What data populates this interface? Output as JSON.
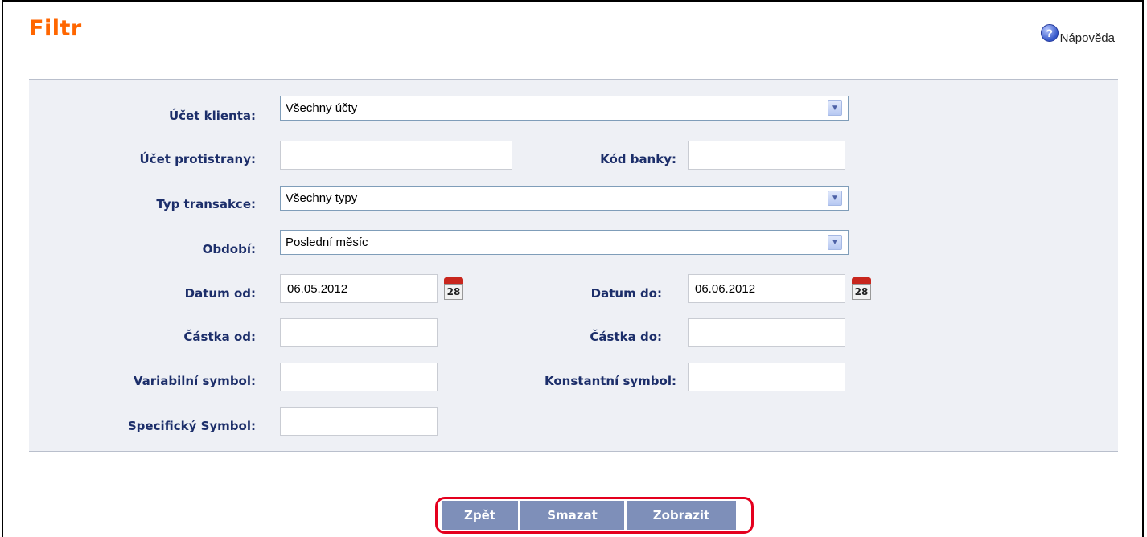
{
  "header": {
    "title": "Filtr",
    "help_label": "Nápověda"
  },
  "form": {
    "ucet_klienta": {
      "label": "Účet klienta:",
      "value": "Všechny účty"
    },
    "ucet_protistrany": {
      "label": "Účet protistrany:",
      "value": ""
    },
    "kod_banky": {
      "label": "Kód banky:",
      "value": ""
    },
    "typ_transakce": {
      "label": "Typ transakce:",
      "value": "Všechny typy"
    },
    "obdobi": {
      "label": "Období:",
      "value": "Poslední měsíc"
    },
    "datum_od": {
      "label": "Datum od:",
      "value": "06.05.2012",
      "calendar_day": "28"
    },
    "datum_do": {
      "label": "Datum do:",
      "value": "06.06.2012",
      "calendar_day": "28"
    },
    "castka_od": {
      "label": "Částka od:",
      "value": ""
    },
    "castka_do": {
      "label": "Částka do:",
      "value": ""
    },
    "variabilni_symbol": {
      "label": "Variabilní symbol:",
      "value": ""
    },
    "konstantni_symbol": {
      "label": "Konstantní symbol:",
      "value": ""
    },
    "specificky_symbol": {
      "label": "Specifický Symbol:",
      "value": ""
    }
  },
  "buttons": {
    "back": "Zpět",
    "clear": "Smazat",
    "show": "Zobrazit"
  },
  "colors": {
    "title": "#ff6600",
    "label": "#1c2e6a",
    "button": "#7e8fb9",
    "highlight": "#e4001e",
    "panel": "#eef0f5"
  }
}
